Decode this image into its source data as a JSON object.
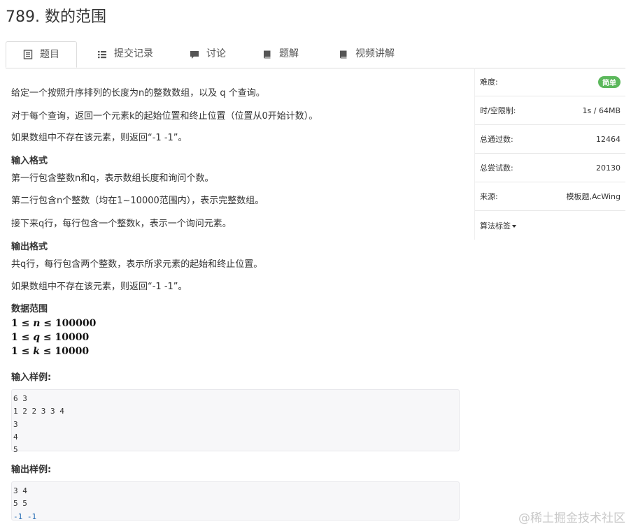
{
  "problem": {
    "title": "789. 数的范围"
  },
  "tabs": [
    {
      "label": "题目",
      "icon": "document-icon",
      "active": true
    },
    {
      "label": "提交记录",
      "icon": "list-icon"
    },
    {
      "label": "讨论",
      "icon": "comment-icon"
    },
    {
      "label": "题解",
      "icon": "book-icon"
    },
    {
      "label": "视频讲解",
      "icon": "book-icon"
    }
  ],
  "description": {
    "p1": "给定一个按照升序排列的长度为n的整数数组，以及 q 个查询。",
    "p2": "对于每个查询，返回一个元素k的起始位置和终止位置（位置从0开始计数）。",
    "p3": "如果数组中不存在该元素，则返回“-1 -1”。",
    "input_heading": "输入格式",
    "input_p1": "第一行包含整数n和q，表示数组长度和询问个数。",
    "input_p2": "第二行包含n个整数（均在1~10000范围内），表示完整数组。",
    "input_p3": "接下来q行，每行包含一个整数k，表示一个询问元素。",
    "output_heading": "输出格式",
    "output_p1": "共q行，每行包含两个整数，表示所求元素的起始和终止位置。",
    "output_p2": "如果数组中不存在该元素，则返回“-1 -1”。",
    "range_heading": "数据范围",
    "range": [
      {
        "lhs": "1 ≤ ",
        "var": "n",
        "rhs": " ≤ 100000"
      },
      {
        "lhs": "1 ≤ ",
        "var": "q",
        "rhs": " ≤ 10000"
      },
      {
        "lhs": "1 ≤ ",
        "var": "k",
        "rhs": " ≤ 10000"
      }
    ],
    "sample_input_heading": "输入样例:",
    "sample_input": [
      "6 3",
      "1 2 2 3 3 4",
      "3",
      "4",
      "5"
    ],
    "sample_output_heading": "输出样例:",
    "sample_output": [
      "3 4",
      "5 5",
      "-1 -1"
    ]
  },
  "sidebar": {
    "difficulty_label": "难度:",
    "difficulty_value": "简单",
    "limit_label": "时/空限制:",
    "limit_value": "1s / 64MB",
    "passed_label": "总通过数:",
    "passed_value": "12464",
    "attempts_label": "总尝试数:",
    "attempts_value": "20130",
    "source_label": "来源:",
    "source_value": "模板题,AcWing",
    "tags_label": "算法标签"
  },
  "watermark": "@稀土掘金技术社区",
  "colors": {
    "badge": "#5cb85c",
    "code_bg": "#f7f7f9",
    "negative_number": "#2a6fb5"
  }
}
